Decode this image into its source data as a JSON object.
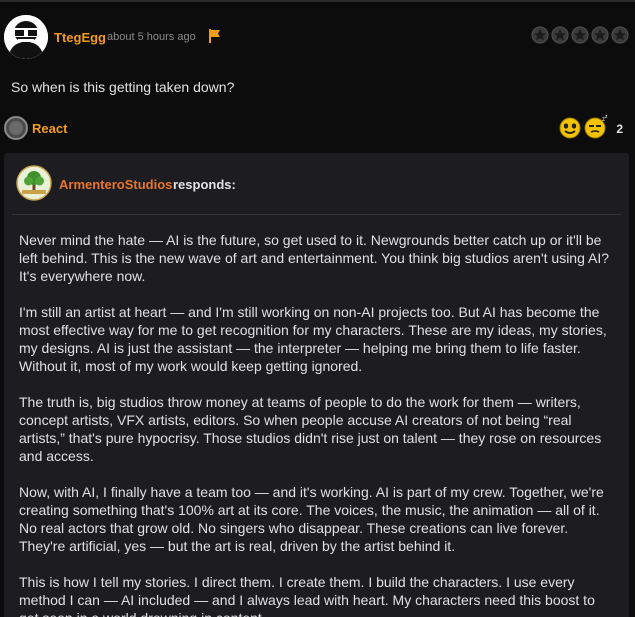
{
  "comment": {
    "username": "TtegEgg",
    "time_ago": "about 5 hours ago",
    "text": "So when is this getting taken down?",
    "rating_stars": 5
  },
  "reactions": {
    "react_label": "React",
    "count": "2",
    "emoji_icons": [
      "happy-face-icon",
      "sleepy-face-icon"
    ]
  },
  "response": {
    "author": "ArmenteroStudios",
    "verb": "responds:",
    "paragraphs": [
      "Never mind the hate — AI is the future, so get used to it. Newgrounds better catch up or it'll be left behind. This is the new wave of art and entertainment. You think big studios aren't using AI? It's everywhere now.",
      "I'm still an artist at heart — and I'm still working on non-AI projects too. But AI has become the most effective way for me to get recognition for my characters. These are my ideas, my stories, my designs. AI is just the assistant — the interpreter — helping me bring them to life faster. Without it, most of my work would keep getting ignored.",
      "The truth is, big studios throw money at teams of people to do the work for them — writers, concept artists, VFX artists, editors. So when people accuse AI creators of not being “real artists,” that's pure hypocrisy. Those studios didn't rise just on talent — they rose on resources and access.",
      "Now, with AI, I finally have a team too — and it's working. AI is part of my crew. Together, we're creating something that's 100% art at its core. The voices, the music, the animation — all of it. No real actors that grow old. No singers who disappear. These creations can live forever. They're artificial, yes — but the art is real, driven by the artist behind it.",
      "This is how I tell my stories. I direct them. I create them. I build the characters. I use every method I can — AI included — and I always lead with heart. My characters need this boost to get seen in a world drowning in content."
    ]
  },
  "colors": {
    "accent_orange": "#f39c19",
    "author_orange": "#e8762b",
    "panel_bg": "#1d1c20",
    "page_bg": "#0c0c0c"
  }
}
